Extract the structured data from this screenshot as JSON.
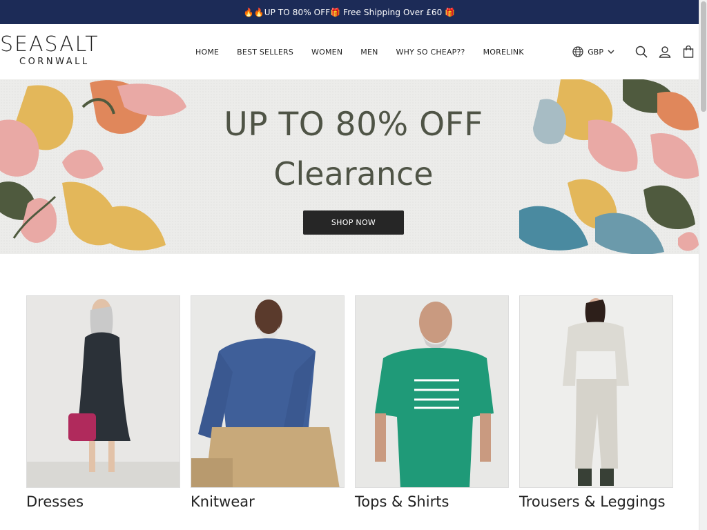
{
  "announcement": {
    "text": "🔥🔥UP TO 80% OFF🎁 Free Shipping Over £60 🎁"
  },
  "logo": {
    "line1": "SEASALT",
    "line2": "CORNWALL"
  },
  "nav": [
    {
      "label": "HOME"
    },
    {
      "label": "BEST SELLERS"
    },
    {
      "label": "WOMEN"
    },
    {
      "label": "MEN"
    },
    {
      "label": "WHY SO CHEAP??"
    },
    {
      "label": "MORELINK"
    }
  ],
  "tools": {
    "currency": "GBP",
    "icons": [
      "globe-icon",
      "chevron-down-icon",
      "search-icon",
      "user-icon",
      "bag-icon"
    ]
  },
  "hero": {
    "headline": "UP TO 80% OFF",
    "subheadline": "Clearance",
    "button_label": "SHOP NOW"
  },
  "categories": [
    {
      "label": "Dresses"
    },
    {
      "label": "Knitwear"
    },
    {
      "label": "Tops & Shirts"
    },
    {
      "label": "Trousers & Leggings"
    }
  ],
  "colors": {
    "announce_bg": "#1c2b57",
    "hero_text": "#4f5446",
    "button_bg": "#262626"
  }
}
